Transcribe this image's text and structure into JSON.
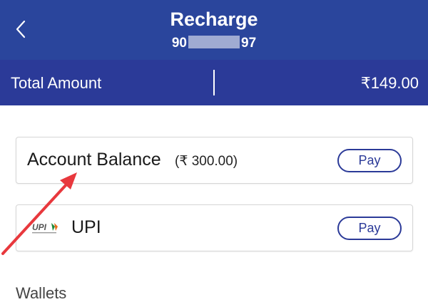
{
  "header": {
    "title": "Recharge",
    "number_prefix": "90",
    "number_suffix": "97",
    "back_icon": "chevron-left-icon"
  },
  "total": {
    "label": "Total Amount",
    "value": "₹149.00"
  },
  "payment_options": [
    {
      "label": "Account Balance",
      "balance": "(₹ 300.00)",
      "action": "Pay"
    },
    {
      "label": "UPI",
      "logo_text": "UPI",
      "action": "Pay"
    }
  ],
  "sections": {
    "wallets": "Wallets"
  },
  "colors": {
    "header_bg": "#2a459c",
    "total_bg": "#2b3a98",
    "accent": "#2b3a98",
    "annotation_arrow": "#e8383d"
  }
}
